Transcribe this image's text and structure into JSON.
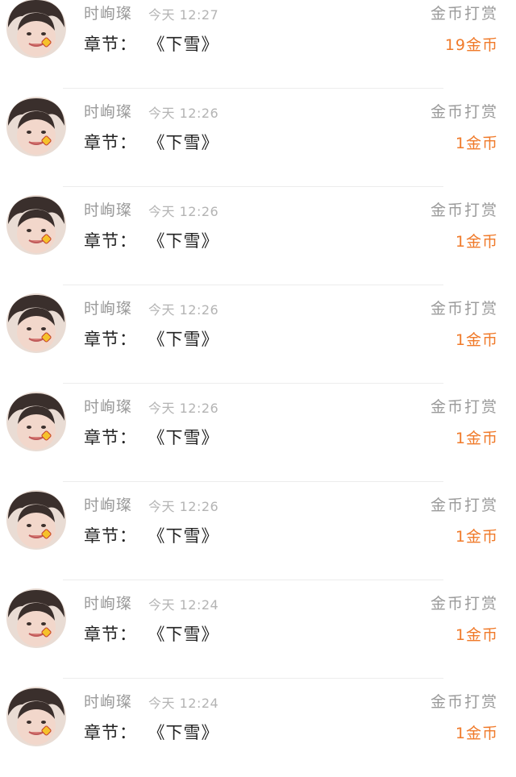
{
  "colors": {
    "accent_orange": "#f07a2a",
    "muted_gray": "#9a9a9a",
    "text_dark": "#222222"
  },
  "rewards": [
    {
      "avatar_icon": "user-avatar-icon",
      "name": "时峋璨",
      "time": "今天 12:27",
      "reward_type": "金币打赏",
      "chapter_label": "章节：",
      "chapter_title": "《下雪》",
      "amount": "19金币"
    },
    {
      "avatar_icon": "user-avatar-icon",
      "name": "时峋璨",
      "time": "今天 12:26",
      "reward_type": "金币打赏",
      "chapter_label": "章节：",
      "chapter_title": "《下雪》",
      "amount": "1金币"
    },
    {
      "avatar_icon": "user-avatar-icon",
      "name": "时峋璨",
      "time": "今天 12:26",
      "reward_type": "金币打赏",
      "chapter_label": "章节：",
      "chapter_title": "《下雪》",
      "amount": "1金币"
    },
    {
      "avatar_icon": "user-avatar-icon",
      "name": "时峋璨",
      "time": "今天 12:26",
      "reward_type": "金币打赏",
      "chapter_label": "章节：",
      "chapter_title": "《下雪》",
      "amount": "1金币"
    },
    {
      "avatar_icon": "user-avatar-icon",
      "name": "时峋璨",
      "time": "今天 12:26",
      "reward_type": "金币打赏",
      "chapter_label": "章节：",
      "chapter_title": "《下雪》",
      "amount": "1金币"
    },
    {
      "avatar_icon": "user-avatar-icon",
      "name": "时峋璨",
      "time": "今天 12:26",
      "reward_type": "金币打赏",
      "chapter_label": "章节：",
      "chapter_title": "《下雪》",
      "amount": "1金币"
    },
    {
      "avatar_icon": "user-avatar-icon",
      "name": "时峋璨",
      "time": "今天 12:24",
      "reward_type": "金币打赏",
      "chapter_label": "章节：",
      "chapter_title": "《下雪》",
      "amount": "1金币"
    },
    {
      "avatar_icon": "user-avatar-icon",
      "name": "时峋璨",
      "time": "今天 12:24",
      "reward_type": "金币打赏",
      "chapter_label": "章节：",
      "chapter_title": "《下雪》",
      "amount": "1金币"
    }
  ]
}
